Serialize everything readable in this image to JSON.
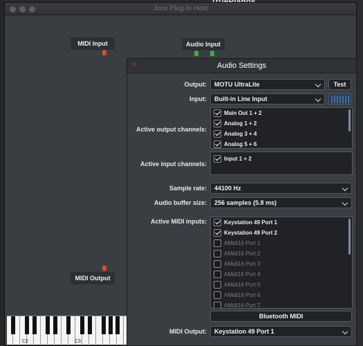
{
  "background": {
    "app_title": "TruePianos"
  },
  "host": {
    "title": "Juce Plug-In Host",
    "nodes": {
      "midi_input": "MIDI Input",
      "audio_input": "Audio Input",
      "midi_output": "MIDI Output"
    },
    "keyboard": {
      "labels": [
        "C2",
        "C3"
      ]
    }
  },
  "audio_settings": {
    "title": "Audio Settings",
    "close_glyph": "×",
    "output": {
      "label": "Output:",
      "value": "MOTU UltraLite",
      "test_label": "Test"
    },
    "input": {
      "label": "Input:",
      "value": "Built-in Line Input"
    },
    "active_output_channels": {
      "label": "Active output channels:",
      "items": [
        {
          "label": "Main Out 1 + 2",
          "checked": true
        },
        {
          "label": "Analog 1 + 2",
          "checked": true
        },
        {
          "label": "Analog 3 + 4",
          "checked": true
        },
        {
          "label": "Analog 5 + 6",
          "checked": true
        }
      ]
    },
    "active_input_channels": {
      "label": "Active input channels:",
      "items": [
        {
          "label": "Input 1 + 2",
          "checked": true
        }
      ]
    },
    "sample_rate": {
      "label": "Sample rate:",
      "value": "44100 Hz"
    },
    "buffer_size": {
      "label": "Audio buffer size:",
      "value": "256 samples (5.8 ms)"
    },
    "active_midi_inputs": {
      "label": "Active MIDI inputs:",
      "items": [
        {
          "label": "Keystation 49 Port 1",
          "checked": true
        },
        {
          "label": "Keystation 49 Port 2",
          "checked": true
        },
        {
          "label": "AMidi16 Port 1",
          "checked": false
        },
        {
          "label": "AMidi16 Port 2",
          "checked": false
        },
        {
          "label": "AMidi16 Port 3",
          "checked": false
        },
        {
          "label": "AMidi16 Port 4",
          "checked": false
        },
        {
          "label": "AMidi16 Port 5",
          "checked": false
        },
        {
          "label": "AMidi16 Port 6",
          "checked": false
        },
        {
          "label": "AMidi16 Port 7",
          "checked": false
        }
      ]
    },
    "bluetooth_midi_label": "Bluetooth MIDI",
    "midi_output": {
      "label": "MIDI Output:",
      "value": "Keystation 49 Port 1"
    }
  },
  "colors": {
    "accent_pin_red": "#e04a2a",
    "accent_pin_green": "#3fae3f",
    "scrollbar": "#7f8aa8"
  }
}
